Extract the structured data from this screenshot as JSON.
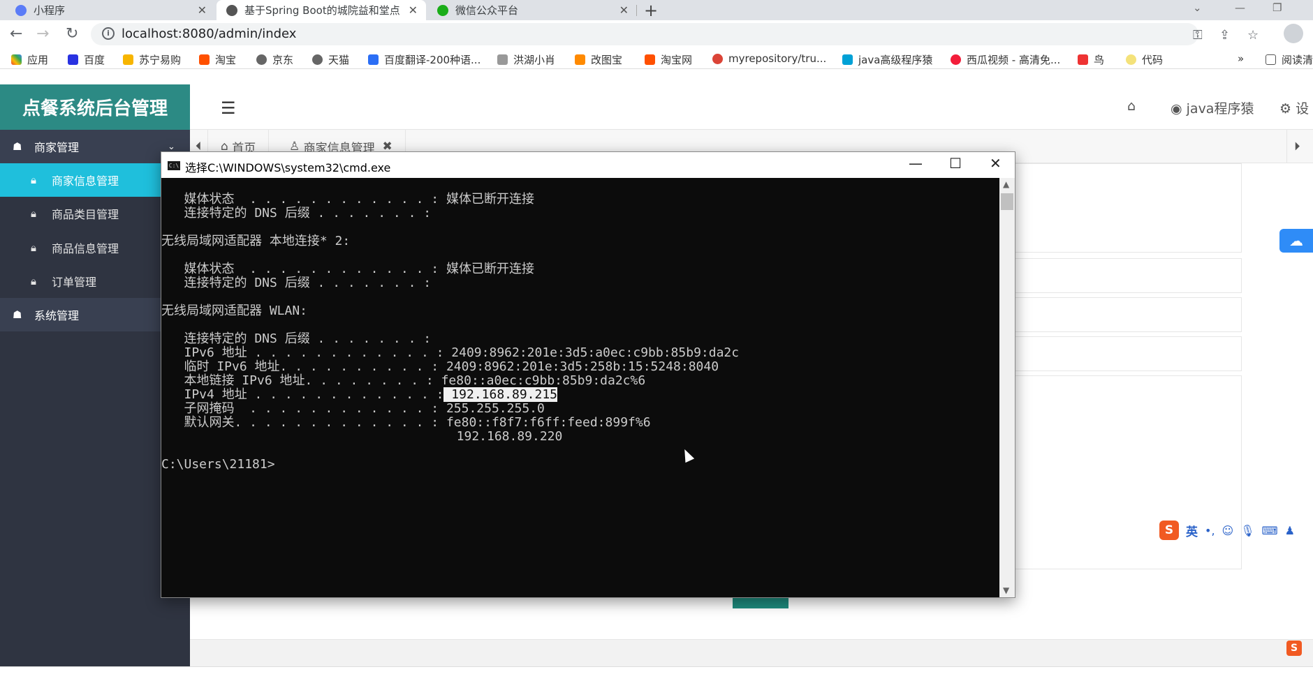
{
  "browser": {
    "tabs": [
      {
        "label": "小程序",
        "close": "✕"
      },
      {
        "label": "基于Spring Boot的城院益和堂点",
        "close": "✕"
      },
      {
        "label": "微信公众平台",
        "close": "✕"
      }
    ],
    "new_tab": "+",
    "url": "localhost:8080/admin/index",
    "bookmarks": [
      "应用",
      "百度",
      "苏宁易购",
      "淘宝",
      "京东",
      "天猫",
      "百度翻译-200种语...",
      "洪湖小肖",
      "改图宝",
      "淘宝网",
      "myrepository/tru...",
      "java高级程序猿",
      "西瓜视频 - 高清免...",
      "鸟",
      "代码"
    ],
    "bookmark_more": "»",
    "reading_list": "阅读清"
  },
  "sidebar": {
    "brand": "点餐系统后台管理",
    "groups": [
      {
        "label": "商家管理",
        "arrow": "⌄"
      },
      {
        "label": "系统管理"
      }
    ],
    "items": [
      "商家信息管理",
      "商品类目管理",
      "商品信息管理",
      "订单管理"
    ]
  },
  "topbar": {
    "user": "java程序猿",
    "settings": "设"
  },
  "page_tabs": {
    "home": "首页",
    "current": "商家信息管理",
    "close": "✖"
  },
  "cmd": {
    "title": "选择C:\\WINDOWS\\system32\\cmd.exe",
    "lines": [
      "   媒体状态  . . . . . . . . . . . . : 媒体已断开连接",
      "   连接特定的 DNS 后缀 . . . . . . . :",
      "",
      "无线局域网适配器 本地连接* 2:",
      "",
      "   媒体状态  . . . . . . . . . . . . : 媒体已断开连接",
      "   连接特定的 DNS 后缀 . . . . . . . :",
      "",
      "无线局域网适配器 WLAN:",
      "",
      "   连接特定的 DNS 后缀 . . . . . . . :",
      "   IPv6 地址 . . . . . . . . . . . . : 2409:8962:201e:3d5:a0ec:c9bb:85b9:da2c",
      "   临时 IPv6 地址. . . . . . . . . . : 2409:8962:201e:3d5:258b:15:5248:8040",
      "   本地链接 IPv6 地址. . . . . . . . : fe80::a0ec:c9bb:85b9:da2c%6",
      "   IPv4 地址 . . . . . . . . . . . . :",
      "   子网掩码  . . . . . . . . . . . . : 255.255.255.0",
      "   默认网关. . . . . . . . . . . . . : fe80::f8f7:f6ff:feed:899f%6",
      "                                       192.168.89.220",
      "",
      "C:\\Users\\21181>"
    ],
    "ipv4_value": " 192.168.89.215"
  },
  "ime": {
    "logo": "S",
    "mode": "英"
  },
  "colors": {
    "brand": "#2c8a84",
    "sidebar_bg": "#2f3441",
    "active_item": "#1fbfdc",
    "cmd_bg": "#0c0c0c"
  }
}
